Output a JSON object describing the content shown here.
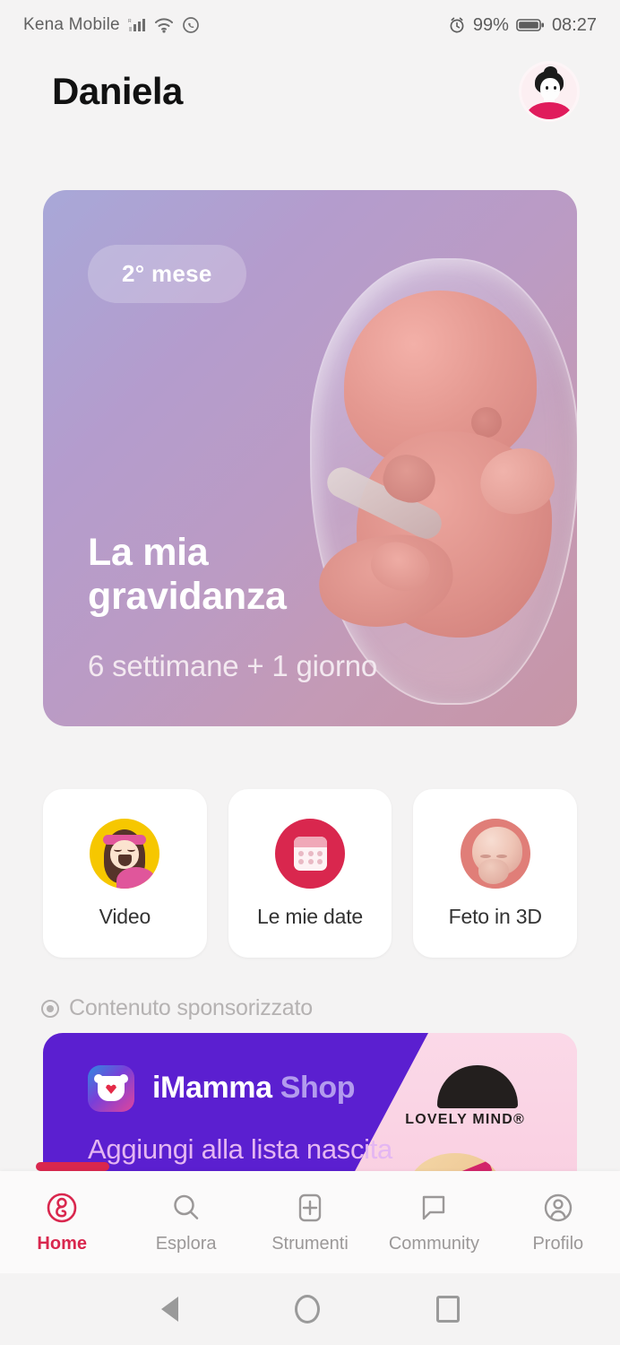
{
  "status_bar": {
    "carrier": "Kena Mobile",
    "signal_icon": "signal-bars-icon",
    "wifi_icon": "wifi-icon",
    "whatsapp_icon": "whatsapp-icon",
    "alarm_icon": "alarm-clock-icon",
    "battery_percent": "99%",
    "battery_icon": "battery-icon",
    "time": "08:27"
  },
  "header": {
    "title": "Daniela",
    "avatar_icon": "user-avatar"
  },
  "hero": {
    "badge": "2° mese",
    "title": "La mia gravidanza",
    "subtitle": "6 settimane + 1 giorno",
    "illustration": "fetus-in-amniotic-sac-illustration",
    "gradient_from": "#a8a8d8",
    "gradient_to": "#c795a6"
  },
  "quick_actions": [
    {
      "label": "Video",
      "icon": "video-girl-icon",
      "icon_color": "#f6c700"
    },
    {
      "label": "Le mie date",
      "icon": "calendar-icon",
      "icon_color": "#d9274e"
    },
    {
      "label": "Feto in 3D",
      "icon": "fetus-3d-icon",
      "icon_color": "#e07e78"
    }
  ],
  "sponsored": {
    "label": "Contenuto sponsorizzato",
    "label_icon": "target-icon",
    "brand": "iMamma",
    "brand_suffix": "Shop",
    "cta": "Aggiungi alla lista nascita",
    "partner_logo_text": "LOVELY MIND®",
    "app_icon": "imamma-onesie-icon",
    "background_color": "#5b1fd0",
    "panel_color": "#fbd6e6"
  },
  "bottom_nav": {
    "active_color": "#d9274e",
    "items": [
      {
        "label": "Home",
        "icon": "home-pregnancy-icon",
        "active": true
      },
      {
        "label": "Esplora",
        "icon": "search-icon",
        "active": false
      },
      {
        "label": "Strumenti",
        "icon": "plus-square-icon",
        "active": false
      },
      {
        "label": "Community",
        "icon": "chat-bubble-icon",
        "active": false
      },
      {
        "label": "Profilo",
        "icon": "profile-circle-icon",
        "active": false
      }
    ]
  },
  "android_nav": {
    "back_icon": "back-triangle-icon",
    "home_icon": "home-circle-icon",
    "recents_icon": "recents-square-icon"
  }
}
